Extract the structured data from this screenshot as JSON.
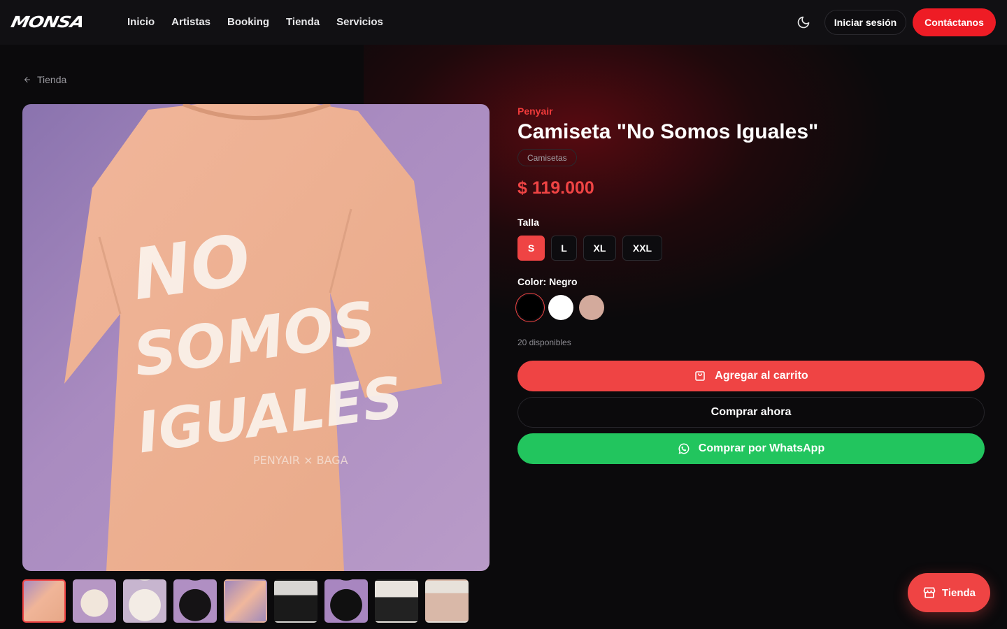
{
  "header": {
    "logo_text": "MONSA",
    "nav": [
      "Inicio",
      "Artistas",
      "Booking",
      "Tienda",
      "Servicios"
    ],
    "login_label": "Iniciar sesión",
    "contact_label": "Contáctanos",
    "theme_icon": "moon-icon"
  },
  "breadcrumb": {
    "label": "Tienda",
    "icon": "arrow-left-icon"
  },
  "product": {
    "brand": "Penyair",
    "title": "Camiseta \"No Somos Iguales\"",
    "category": "Camisetas",
    "price": "$ 119.000",
    "size_label": "Talla",
    "sizes": [
      "S",
      "L",
      "XL",
      "XXL"
    ],
    "selected_size": "S",
    "color_label": "Color: Negro",
    "colors": [
      {
        "name": "Negro",
        "hex": "#000000",
        "selected": true
      },
      {
        "name": "Blanco",
        "hex": "#ffffff",
        "selected": false
      },
      {
        "name": "Rosa",
        "hex": "#d3aa9c",
        "selected": false
      }
    ],
    "stock": "20 disponibles",
    "print_text": [
      "NO",
      "SOMOS",
      "IGUALES"
    ],
    "tag_text": "PENYAIR × BAGA"
  },
  "actions": {
    "add_to_cart": "Agregar al carrito",
    "buy_now": "Comprar ahora",
    "whatsapp": "Comprar por WhatsApp"
  },
  "fab": {
    "label": "Tienda",
    "icon": "store-icon"
  },
  "colors": {
    "accent": "#ef4444",
    "whatsapp": "#22c55e",
    "background": "#0b0a0c"
  }
}
